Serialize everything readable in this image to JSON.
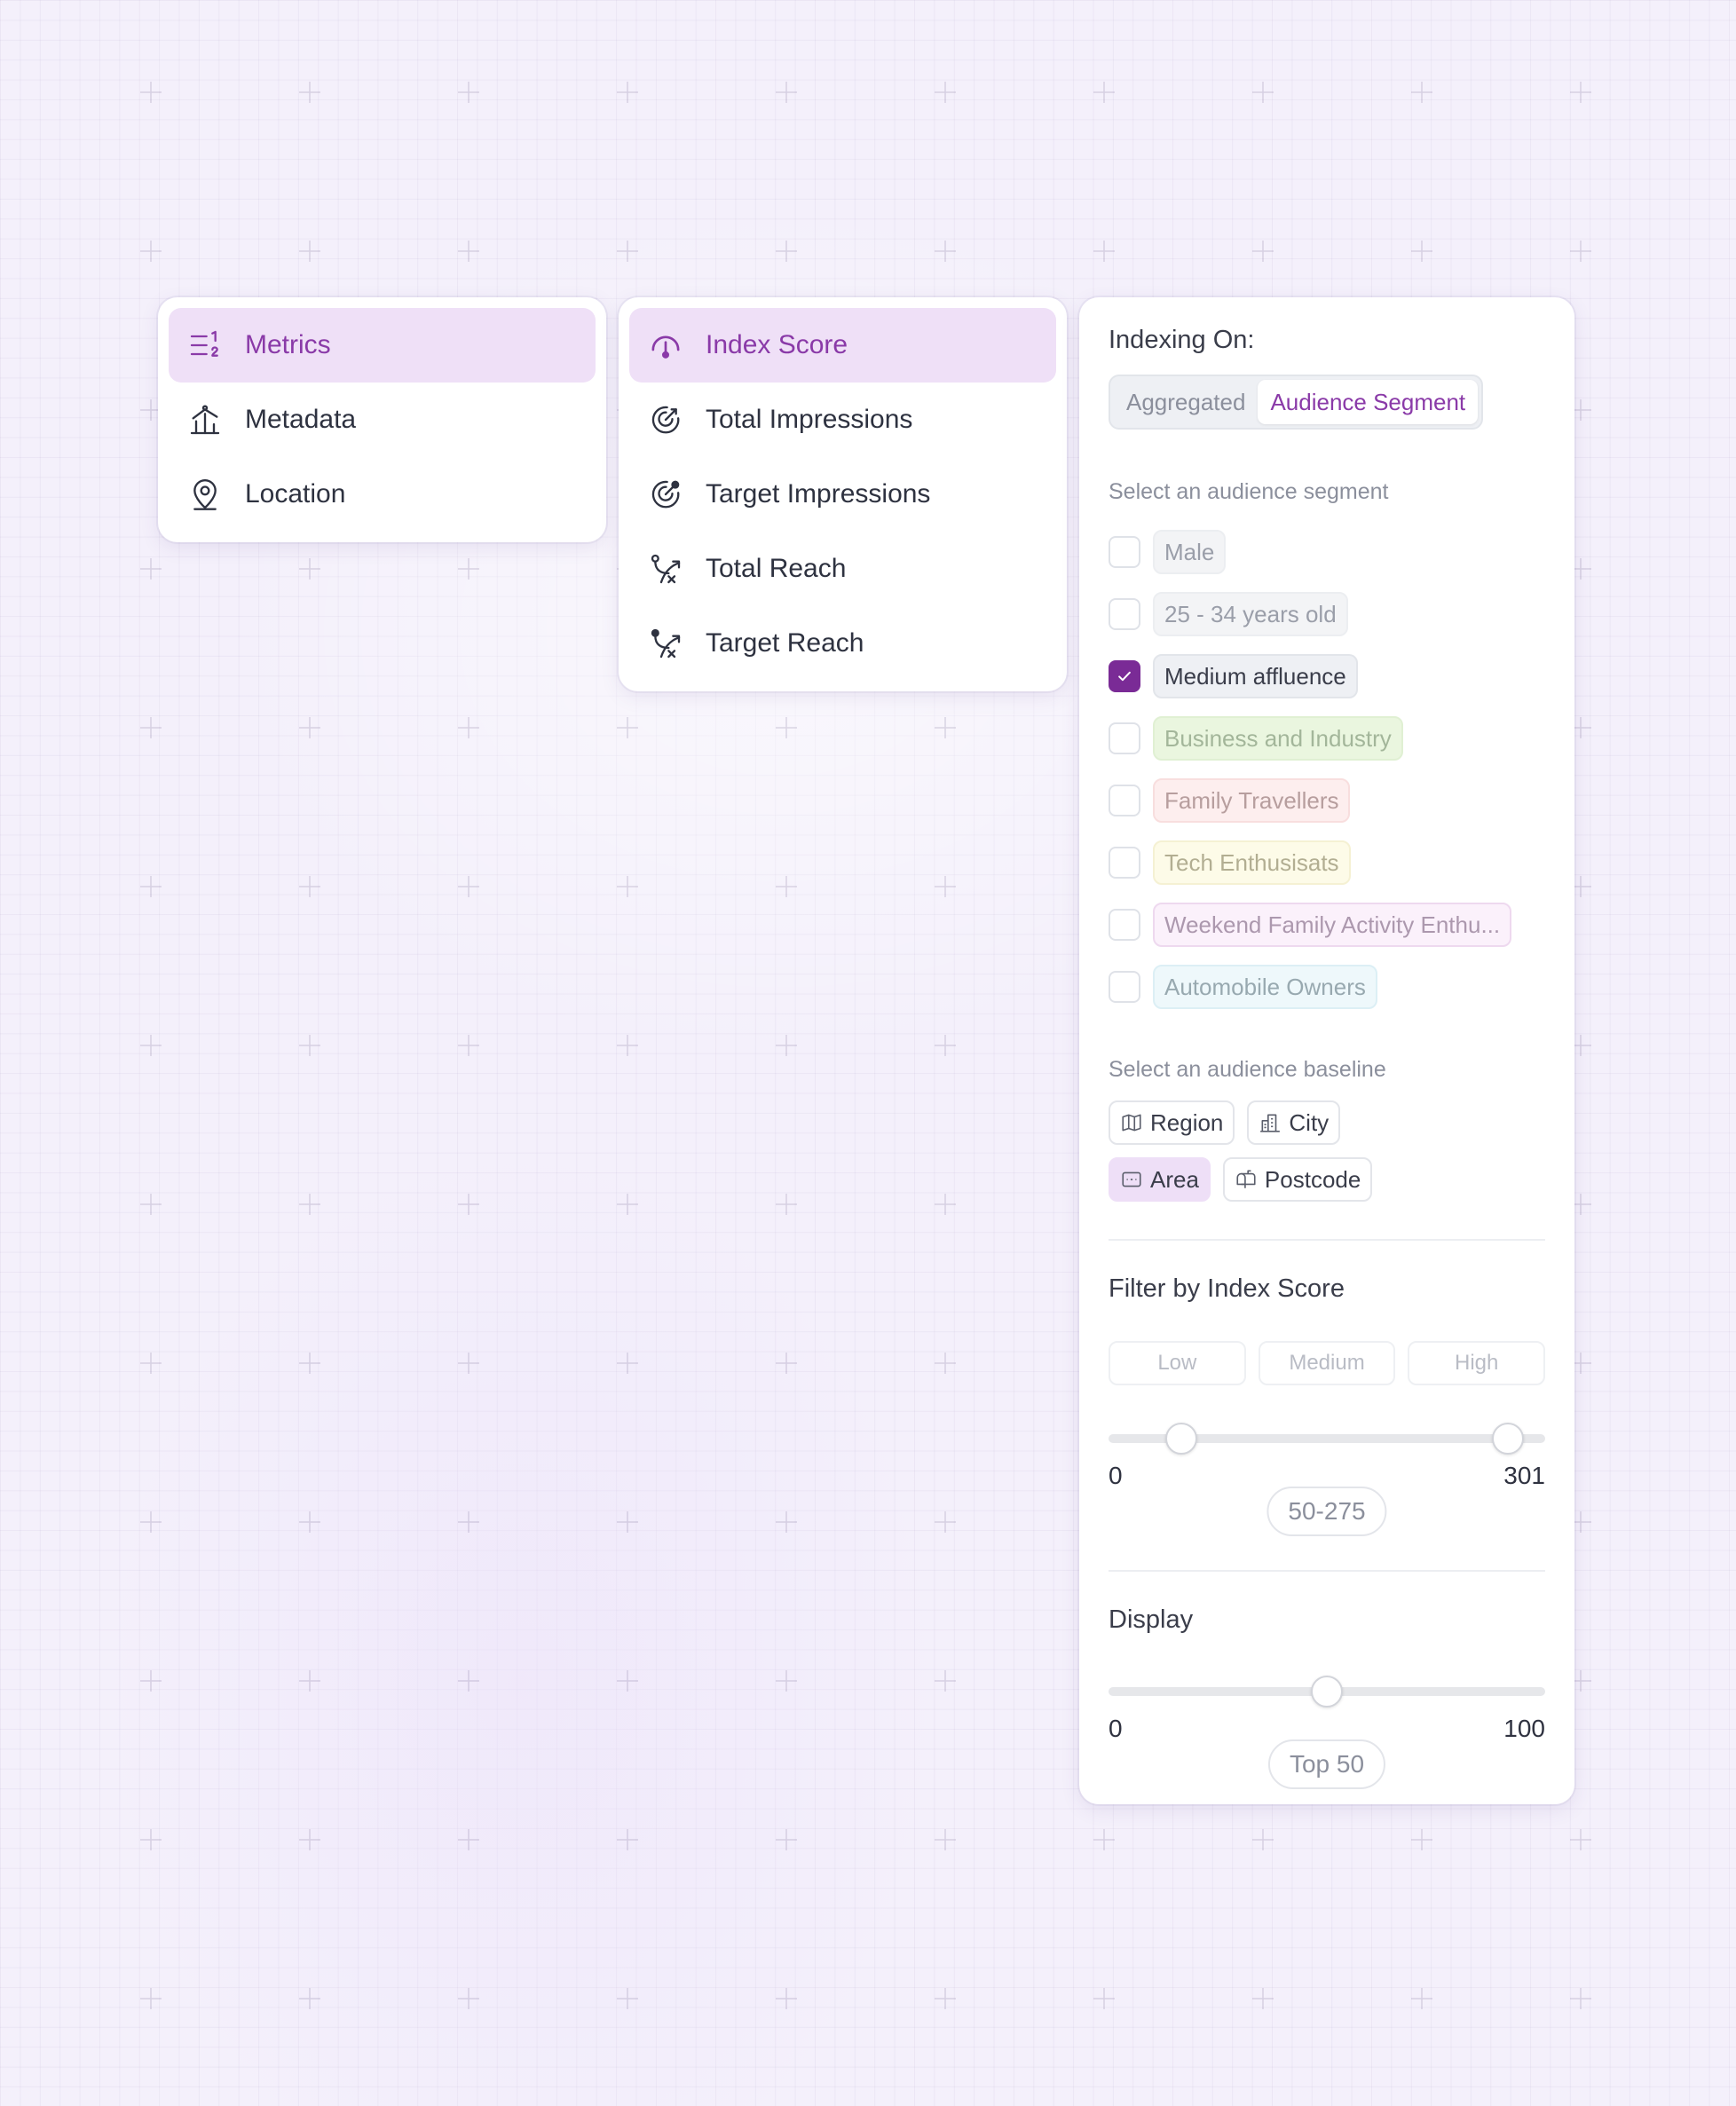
{
  "colors": {
    "accent": "#8a3aa8",
    "checkbox_on": "#7a2b96",
    "active_bg": "#efe0f7"
  },
  "left_menu": {
    "items": [
      {
        "label": "Metrics",
        "icon": "list-numbered-icon",
        "active": true
      },
      {
        "label": "Metadata",
        "icon": "bar-chart-icon",
        "active": false
      },
      {
        "label": "Location",
        "icon": "map-pin-icon",
        "active": false
      }
    ]
  },
  "metric_menu": {
    "items": [
      {
        "label": "Index Score",
        "icon": "gauge-icon",
        "active": true
      },
      {
        "label": "Total Impressions",
        "icon": "target-icon",
        "active": false
      },
      {
        "label": "Target Impressions",
        "icon": "target-icon",
        "active": false
      },
      {
        "label": "Total Reach",
        "icon": "route-icon",
        "active": false
      },
      {
        "label": "Target Reach",
        "icon": "route-icon",
        "active": false
      }
    ]
  },
  "panel": {
    "indexing_label": "Indexing On:",
    "toggle": {
      "options": [
        "Aggregated",
        "Audience Segment"
      ],
      "selected": "Audience Segment"
    },
    "segment_label": "Select an audience segment",
    "segments": [
      {
        "label": "Male",
        "checked": false,
        "bg": "#f3f4f6",
        "border": "#eceef1",
        "color": "#9a9ea9"
      },
      {
        "label": "25 - 34 years old",
        "checked": false,
        "bg": "#f3f4f6",
        "border": "#eceef1",
        "color": "#9a9ea9"
      },
      {
        "label": "Medium affluence",
        "checked": true,
        "bg": "#eef0f4",
        "border": "#e2e5ea",
        "color": "#3a3d4a"
      },
      {
        "label": "Business and Industry",
        "checked": false,
        "bg": "#eaf6df",
        "border": "#e0f0d3",
        "color": "#a3b69a"
      },
      {
        "label": "Family Travellers",
        "checked": false,
        "bg": "#fdeeee",
        "border": "#f8dede",
        "color": "#b79e9e"
      },
      {
        "label": "Tech Enthusisats",
        "checked": false,
        "bg": "#fdfbe8",
        "border": "#f5f1d3",
        "color": "#b2ae92"
      },
      {
        "label": "Weekend Family Activity Enthu...",
        "checked": false,
        "bg": "#fbf1fb",
        "border": "#eed9ef",
        "color": "#ac98ae"
      },
      {
        "label": "Automobile Owners",
        "checked": false,
        "bg": "#eef8fb",
        "border": "#dceff5",
        "color": "#98a9b0"
      }
    ],
    "baseline_label": "Select an audience baseline",
    "baselines": [
      {
        "label": "Region",
        "icon": "map-icon",
        "selected": false
      },
      {
        "label": "City",
        "icon": "building-icon",
        "selected": false
      },
      {
        "label": "Area",
        "icon": "area-icon",
        "selected": true
      },
      {
        "label": "Postcode",
        "icon": "mailbox-icon",
        "selected": false
      }
    ],
    "filter": {
      "title": "Filter by Index Score",
      "buttons": [
        "Low",
        "Medium",
        "High"
      ],
      "min": 0,
      "max": 301,
      "min_label": "0",
      "max_label": "301",
      "value_low": 50,
      "value_high": 275,
      "value_label": "50-275"
    },
    "display": {
      "title": "Display",
      "min": 0,
      "max": 100,
      "min_label": "0",
      "max_label": "100",
      "value": 50,
      "value_label": "Top 50"
    }
  }
}
